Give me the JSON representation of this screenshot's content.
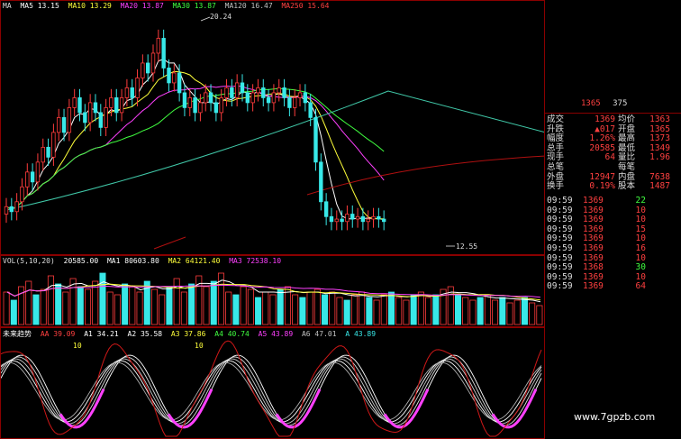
{
  "colors": {
    "up": "#ff3c3c",
    "down": "#38e8e8",
    "ma5": "#ffffff",
    "ma10": "#ffff3a",
    "ma20": "#ff40ff",
    "ma30": "#40ff40",
    "ma120": "#c0c0c0",
    "ma250": "#ff4040"
  },
  "price_legend": {
    "ma": "MA",
    "ma5": "MA5 13.15",
    "ma10": "MA10 13.29",
    "ma20": "MA20 13.87",
    "ma30": "MA30 13.87",
    "ma120": "MA120 16.47",
    "ma250": "MA250 15.64",
    "high_label": "20.24",
    "low_label": "12.55"
  },
  "vol_legend": {
    "name": "VOL(5,10,20)",
    "vol": "20585.00",
    "ma1": "MA1 80603.80",
    "ma2": "MA2 64121.40",
    "ma3": "MA3 72538.10"
  },
  "ind_legend": {
    "name": "未来趋势",
    "a": "AA 39.09",
    "a1": "A1 34.21",
    "a2": "A2 35.58",
    "a3": "A3 37.86",
    "a4": "A4 40.74",
    "a5": "A5 43.89",
    "a6": "A6 47.01",
    "a7": "A 43.89",
    "marker1": "10",
    "marker2": "10"
  },
  "sidebar": {
    "top_val1": "1365",
    "top_val2": "375",
    "quote": [
      {
        "l": "成交",
        "v": "1369",
        "l2": "均价",
        "v2": "1363"
      },
      {
        "l": "升跌",
        "v": "▲017",
        "l2": "开盘",
        "v2": "1365"
      },
      {
        "l": "幅度",
        "v": "1.26%",
        "l2": "最高",
        "v2": "1373"
      },
      {
        "l": "总手",
        "v": "20585",
        "l2": "最低",
        "v2": "1349"
      },
      {
        "l": "现手",
        "v": "64",
        "l2": "量比",
        "v2": "1.96"
      },
      {
        "l": "总笔",
        "v": "",
        "l2": "每笔",
        "v2": ""
      },
      {
        "l": "外盘",
        "v": "12947",
        "l2": "内盘",
        "v2": "7638"
      },
      {
        "l": "换手",
        "v": "0.19%",
        "l2": "股本",
        "v2": "1487"
      }
    ],
    "ticks": [
      {
        "t": "09:59",
        "p": "1369",
        "v": "22",
        "c": "#40ff40"
      },
      {
        "t": "09:59",
        "p": "1369",
        "v": "10",
        "c": "#ff4040"
      },
      {
        "t": "09:59",
        "p": "1369",
        "v": "10",
        "c": "#ff4040"
      },
      {
        "t": "09:59",
        "p": "1369",
        "v": "15",
        "c": "#ff4040"
      },
      {
        "t": "09:59",
        "p": "1369",
        "v": "10",
        "c": "#ff4040"
      },
      {
        "t": "09:59",
        "p": "1369",
        "v": "16",
        "c": "#ff4040"
      },
      {
        "t": "09:59",
        "p": "1369",
        "v": "10",
        "c": "#ff4040"
      },
      {
        "t": "09:59",
        "p": "1368",
        "v": "30",
        "c": "#40ff40"
      },
      {
        "t": "09:59",
        "p": "1369",
        "v": "10",
        "c": "#ff4040"
      },
      {
        "t": "09:59",
        "p": "1369",
        "v": "64",
        "c": "#ff4040"
      }
    ]
  },
  "watermark": "www.7gpzb.com",
  "chart_data": [
    {
      "type": "candlestick",
      "ylim": [
        11.5,
        21
      ],
      "high_value": 20.24,
      "low_value": 12.55,
      "close_path": [
        13.2,
        13.0,
        13.4,
        14.0,
        14.6,
        14.2,
        15.0,
        15.6,
        15.2,
        16.2,
        16.8,
        16.2,
        17.2,
        17.6,
        17.0,
        16.6,
        17.4,
        17.0,
        16.4,
        17.2,
        17.6,
        17.0,
        17.6,
        18.0,
        17.6,
        18.4,
        19.0,
        18.6,
        19.4,
        20.0,
        18.8,
        18.2,
        18.6,
        17.8,
        17.2,
        17.6,
        17.0,
        17.4,
        17.8,
        17.4,
        17.0,
        17.6,
        18.0,
        17.6,
        18.2,
        17.8,
        17.4,
        17.8,
        18.0,
        17.6,
        17.4,
        17.8,
        18.0,
        17.6,
        17.2,
        17.6,
        17.8,
        17.4,
        16.8,
        15.0,
        13.4,
        12.8,
        12.6,
        12.7,
        12.6,
        12.9,
        12.7,
        12.8,
        12.6,
        12.7,
        12.8,
        12.7,
        12.6
      ]
    },
    {
      "type": "bar",
      "title": "VOL(5,10,20)",
      "volume_path": [
        60,
        45,
        70,
        80,
        55,
        65,
        90,
        75,
        60,
        85,
        70,
        65,
        80,
        95,
        60,
        55,
        75,
        70,
        60,
        80,
        65,
        55,
        70,
        85,
        60,
        75,
        90,
        70,
        80,
        95,
        60,
        55,
        70,
        65,
        50,
        60,
        55,
        65,
        70,
        55,
        50,
        60,
        65,
        55,
        60,
        50,
        45,
        55,
        60,
        50,
        45,
        55,
        60,
        50,
        45,
        55,
        60,
        50,
        55,
        65,
        70,
        55,
        50,
        45,
        50,
        55,
        45,
        50,
        40,
        45,
        50,
        40,
        35
      ]
    },
    {
      "type": "line",
      "title": "未来趋势",
      "ylim": [
        0,
        100
      ],
      "cycles": 5,
      "note": "oscillating trend lines"
    }
  ]
}
